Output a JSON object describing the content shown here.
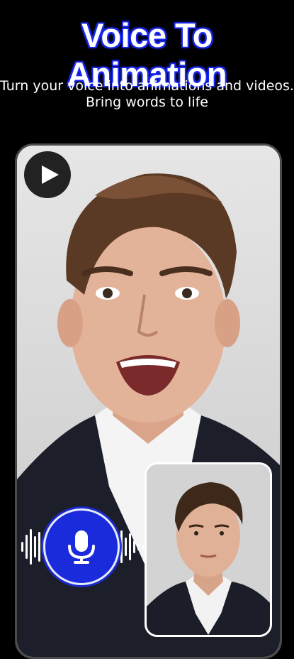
{
  "header": {
    "title": "Voice To Animation",
    "subtitle_line1": "Turn your voice into animations and videos.",
    "subtitle_line2": "Bring words to life"
  },
  "preview": {
    "play_icon": "play-icon",
    "mic_icon": "microphone-icon"
  },
  "colors": {
    "accent": "#1a2bdb",
    "background": "#000000",
    "text": "#ffffff"
  }
}
